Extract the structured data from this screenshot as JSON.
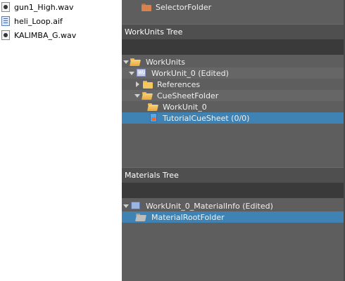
{
  "files": [
    {
      "name": "gun1_High.wav",
      "icon": "wav-file-icon"
    },
    {
      "name": "heli_Loop.aif",
      "icon": "aif-file-icon"
    },
    {
      "name": "KALIMBA_G.wav",
      "icon": "wav-file-icon"
    }
  ],
  "top_tree": {
    "selector_folder": "SelectorFolder"
  },
  "workunits_tree": {
    "title": "WorkUnits Tree",
    "search_value": "",
    "items": {
      "root": "WorkUnits",
      "workunit": "WorkUnit_0 (Edited)",
      "references": "References",
      "cuesheet_folder": "CueSheetFolder",
      "workunit_sub": "WorkUnit_0",
      "tutorial_cuesheet": "TutorialCueSheet (0/0)"
    }
  },
  "materials_tree": {
    "title": "Materials Tree",
    "search_value": "",
    "items": {
      "material_info": "WorkUnit_0_MaterialInfo (Edited)",
      "material_root": "MaterialRootFolder"
    }
  },
  "colors": {
    "panel_bg": "#5e5e5e",
    "header_bg": "#4f4f4f",
    "selection": "#3e83b4",
    "folder": "#f5c75e"
  }
}
